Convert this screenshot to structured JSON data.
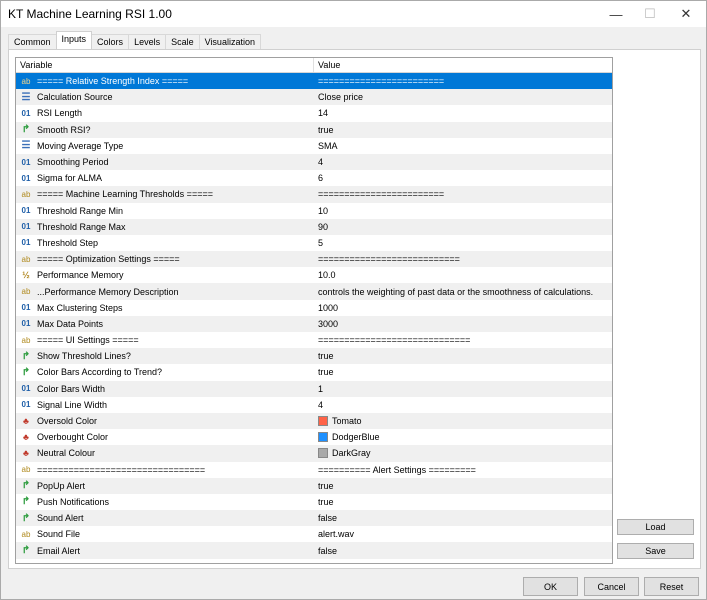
{
  "window": {
    "title": "KT Machine Learning RSI 1.00",
    "minimize_glyph": "—",
    "maximize_glyph": "☐",
    "close_glyph": "✕"
  },
  "tabs": [
    {
      "label": "Common"
    },
    {
      "label": "Inputs"
    },
    {
      "label": "Colors"
    },
    {
      "label": "Levels"
    },
    {
      "label": "Scale"
    },
    {
      "label": "Visualization"
    }
  ],
  "active_tab": "Inputs",
  "grid": {
    "columns": {
      "variable": "Variable",
      "value": "Value"
    },
    "rows": [
      {
        "icon": "ab",
        "variable": "===== Relative Strength Index =====",
        "value": "========================"
      },
      {
        "icon": "list",
        "variable": "Calculation Source",
        "value": "Close price"
      },
      {
        "icon": "num",
        "variable": "RSI Length",
        "value": "14"
      },
      {
        "icon": "bool",
        "variable": "Smooth RSI?",
        "value": "true"
      },
      {
        "icon": "list",
        "variable": "Moving Average Type",
        "value": "SMA"
      },
      {
        "icon": "num",
        "variable": "Smoothing Period",
        "value": "4"
      },
      {
        "icon": "num",
        "variable": "Sigma for ALMA",
        "value": "6"
      },
      {
        "icon": "ab",
        "variable": "===== Machine Learning Thresholds =====",
        "value": "========================"
      },
      {
        "icon": "num",
        "variable": "Threshold Range Min",
        "value": "10"
      },
      {
        "icon": "num",
        "variable": "Threshold Range Max",
        "value": "90"
      },
      {
        "icon": "num",
        "variable": "Threshold Step",
        "value": "5"
      },
      {
        "icon": "ab",
        "variable": "===== Optimization Settings =====",
        "value": "==========================="
      },
      {
        "icon": "frac",
        "variable": "Performance Memory",
        "value": "10.0"
      },
      {
        "icon": "ab",
        "variable": "...Performance Memory Description",
        "value": "controls the weighting of past data or the smoothness of calculations."
      },
      {
        "icon": "num",
        "variable": "Max Clustering Steps",
        "value": "1000"
      },
      {
        "icon": "num",
        "variable": "Max Data Points",
        "value": "3000"
      },
      {
        "icon": "ab",
        "variable": "===== UI Settings =====",
        "value": "============================="
      },
      {
        "icon": "bool",
        "variable": "Show Threshold Lines?",
        "value": "true"
      },
      {
        "icon": "bool",
        "variable": "Color Bars According to Trend?",
        "value": "true"
      },
      {
        "icon": "num",
        "variable": "Color Bars Width",
        "value": "1"
      },
      {
        "icon": "num",
        "variable": "Signal Line Width",
        "value": "4"
      },
      {
        "icon": "color",
        "variable": "Oversold Color",
        "value": "Tomato",
        "swatch": "#ff6347"
      },
      {
        "icon": "color",
        "variable": "Overbought Color",
        "value": "DodgerBlue",
        "swatch": "#1e90ff"
      },
      {
        "icon": "color",
        "variable": "Neutral Colour",
        "value": "DarkGray",
        "swatch": "#a9a9a9"
      },
      {
        "icon": "ab",
        "variable": "================================",
        "value": "========== Alert Settings ========="
      },
      {
        "icon": "bool",
        "variable": "PopUp Alert",
        "value": "true"
      },
      {
        "icon": "bool",
        "variable": "Push Notifications",
        "value": "true"
      },
      {
        "icon": "bool",
        "variable": "Sound Alert",
        "value": "false"
      },
      {
        "icon": "ab",
        "variable": "Sound File",
        "value": "alert.wav"
      },
      {
        "icon": "bool",
        "variable": "Email Alert",
        "value": "false"
      }
    ]
  },
  "icon_glyphs": {
    "ab": "ab",
    "num": "01",
    "bool": "↱",
    "list": "☰",
    "frac": "½",
    "color": "♣"
  },
  "side_buttons": {
    "load": "Load",
    "save": "Save"
  },
  "footer_buttons": {
    "ok": "OK",
    "cancel": "Cancel",
    "reset": "Reset"
  },
  "colors": {
    "selection": "#0078d7"
  }
}
